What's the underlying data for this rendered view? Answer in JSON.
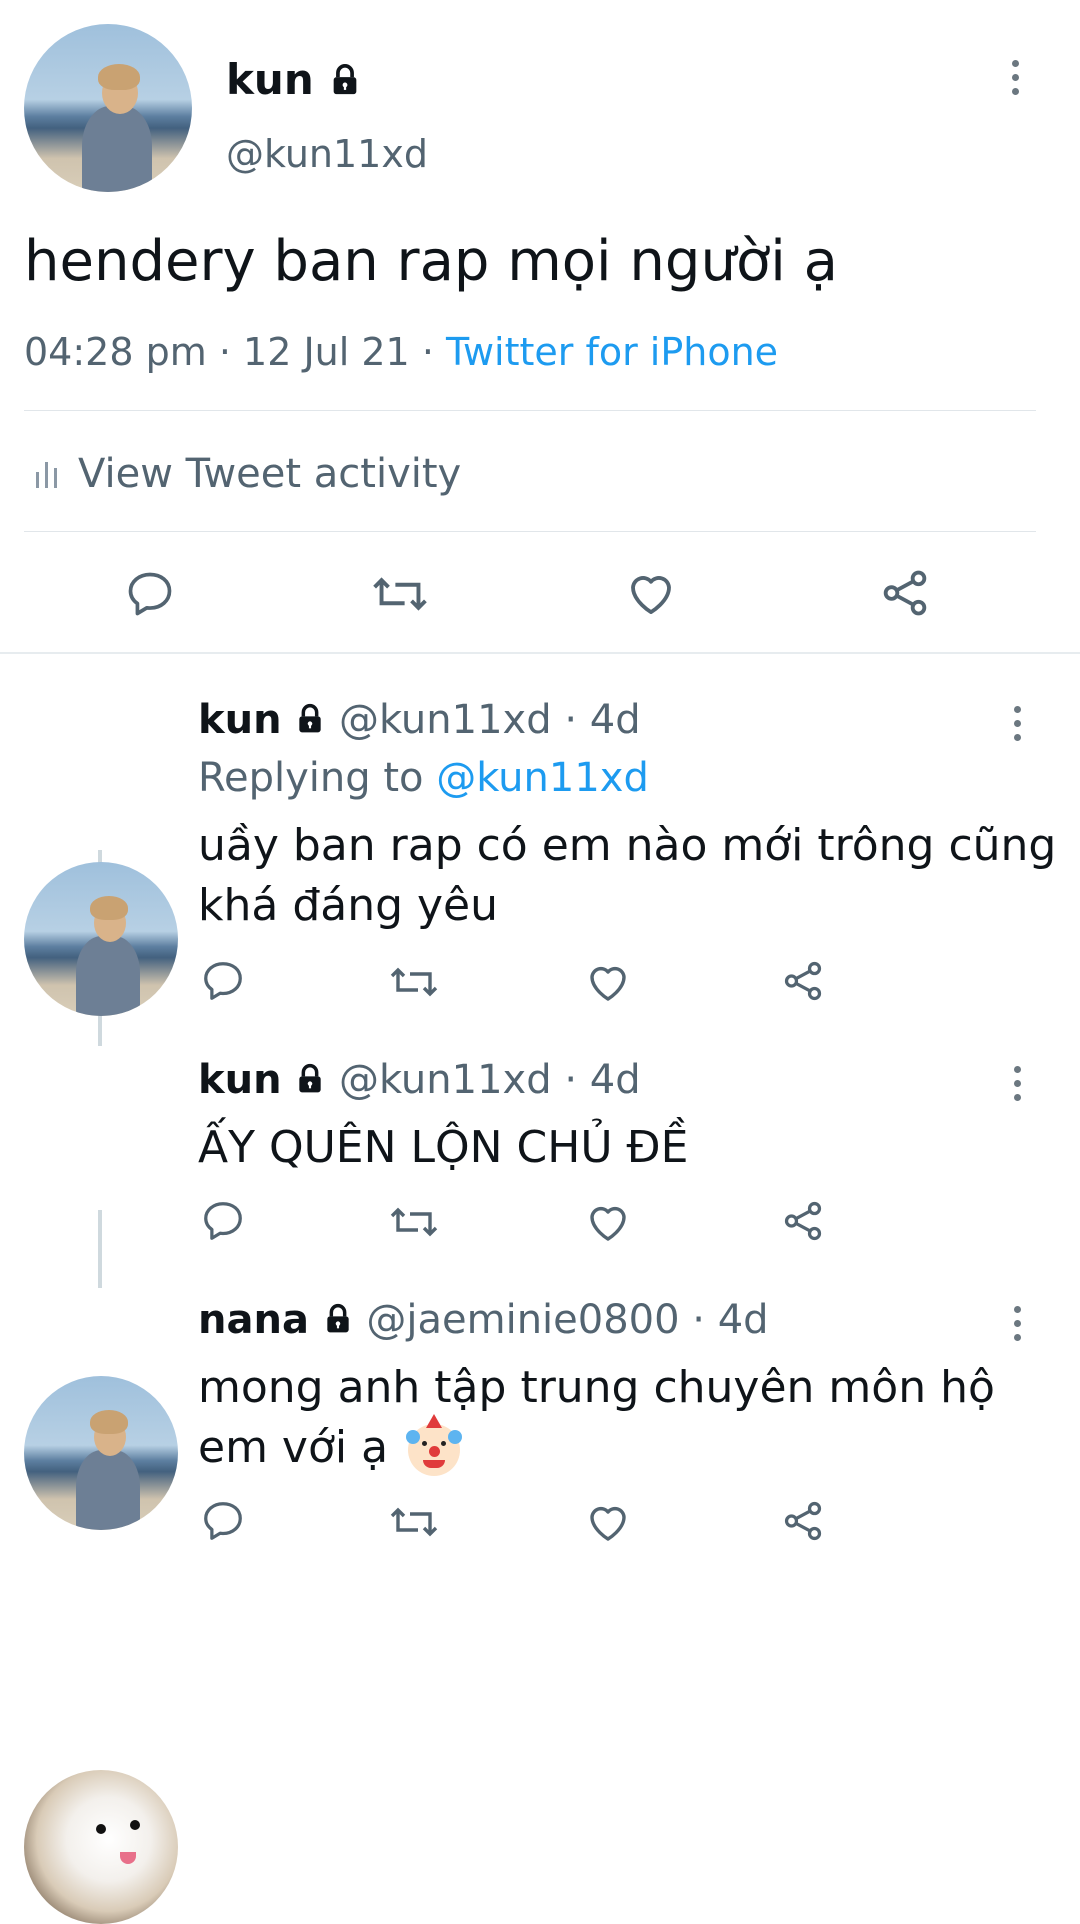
{
  "main_tweet": {
    "author": {
      "name": "kun",
      "handle": "@kun11xd",
      "avatar": "seaside-person-avatar"
    },
    "text": "hendery ban rap mọi người ạ",
    "time": "04:28 pm",
    "date": "12 Jul 21",
    "source": "Twitter for iPhone",
    "activity_label": "View Tweet activity",
    "actions": [
      "reply-icon",
      "retweet-icon",
      "like-icon",
      "share-icon"
    ]
  },
  "replies": [
    {
      "name": "kun",
      "handle": "@kun11xd",
      "age": "4d",
      "replying_prefix": "Replying to",
      "replying_to": "@kun11xd",
      "text_line1": "uầy ban rap có em nào mới trông cũng",
      "text_line2": "khá đáng yêu",
      "avatar": "seaside-person-avatar"
    },
    {
      "name": "kun",
      "handle": "@kun11xd",
      "age": "4d",
      "text": "ẤY QUÊN LỘN CHỦ ĐỀ",
      "avatar": "seaside-person-avatar"
    },
    {
      "name": "nana",
      "handle": "@jaeminie0800",
      "age": "4d",
      "text_line1": "mong anh tập trung chuyên môn hộ",
      "text_line2": "em với ạ",
      "emoji": "clown-face-emoji",
      "avatar": "white-dog-avatar"
    }
  ],
  "separator": "·",
  "colors": {
    "link": "#1d9bf0",
    "muted": "#536471",
    "text": "#0f1419",
    "divider": "#e1e6ea"
  }
}
